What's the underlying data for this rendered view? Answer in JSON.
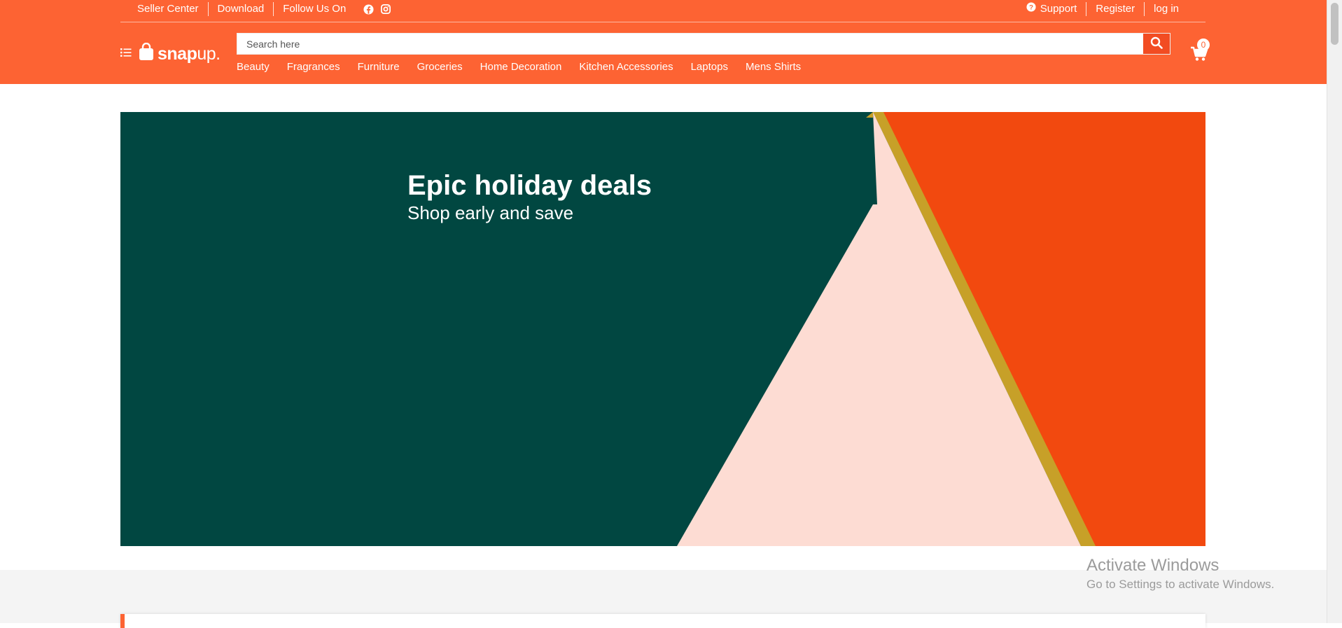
{
  "colors": {
    "brand": "#fd6333",
    "banner_green": "#014741",
    "banner_orange": "#f2490f",
    "banner_pink": "#fddcd3",
    "banner_gold": "#c7a028"
  },
  "topbar": {
    "seller_center": "Seller Center",
    "download": "Download",
    "follow_us_on": "Follow Us On",
    "social_icons": [
      "facebook-icon",
      "instagram-icon"
    ],
    "support": "Support",
    "register": "Register",
    "login": "log in"
  },
  "logo": {
    "text": "snap",
    "suffix": "up."
  },
  "search": {
    "placeholder": "Search here",
    "value": ""
  },
  "cart": {
    "count": "0"
  },
  "categories": [
    "Beauty",
    "Fragrances",
    "Furniture",
    "Groceries",
    "Home Decoration",
    "Kitchen Accessories",
    "Laptops",
    "Mens Shirts"
  ],
  "banner": {
    "title": "Epic holiday deals",
    "subtitle": "Shop early and save"
  },
  "watermark": {
    "title": "Activate Windows",
    "subtitle": "Go to Settings to activate Windows."
  }
}
